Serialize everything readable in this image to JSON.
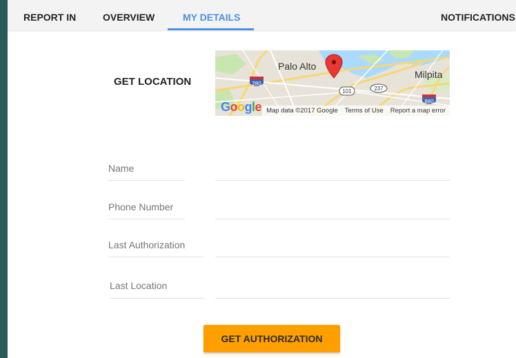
{
  "tabs": [
    {
      "label": "REPORT IN",
      "active": false
    },
    {
      "label": "OVERVIEW",
      "active": false
    },
    {
      "label": "MY DETAILS",
      "active": true
    },
    {
      "label": "NOTIFICATIONS",
      "active": false
    }
  ],
  "location": {
    "label": "GET LOCATION",
    "map": {
      "cities": [
        "Palo Alto",
        "Milpita"
      ],
      "shields": [
        "280",
        "101",
        "237",
        "880"
      ],
      "logo": "Google",
      "attribution": {
        "data": "Map data ©2017 Google",
        "terms": "Terms of Use",
        "report": "Report a map error"
      }
    }
  },
  "form": {
    "fields": [
      {
        "label": "Name",
        "value": ""
      },
      {
        "label": "Phone Number",
        "value": ""
      },
      {
        "label": "Last Authorization",
        "value": ""
      },
      {
        "label": "Last Location",
        "value": ""
      }
    ],
    "submit_label": "GET AUTHORIZATION"
  },
  "colors": {
    "accent": "#4a90e2",
    "button": "#ffa000",
    "background": "#2a5c57",
    "map_pin": "#e53935"
  }
}
